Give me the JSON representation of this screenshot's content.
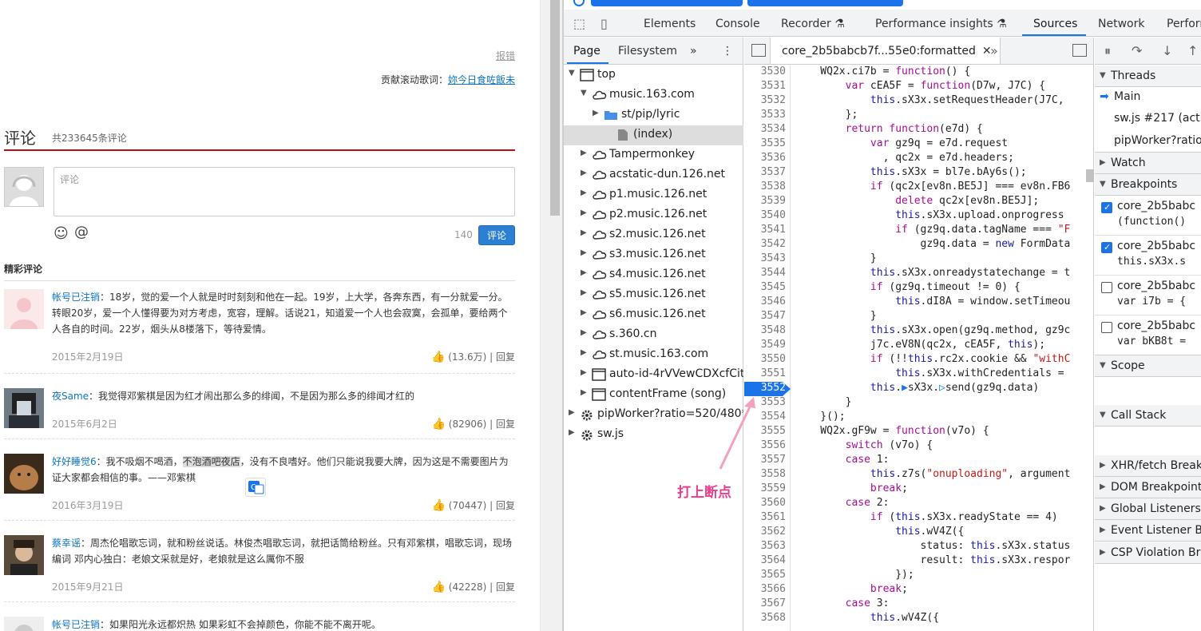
{
  "page": {
    "report_link": "报错",
    "contrib_label": "贡献滚动歌词：",
    "contrib_user": "妳今日食咗飯未",
    "comments_title": "评论",
    "comments_count": "共233645条评论",
    "input_placeholder": "评论",
    "char_count": "140",
    "submit_label": "评论",
    "section_title": "精彩评论",
    "comments": [
      {
        "user": "帐号已注销",
        "text": "：18岁，觉的爱一个人就是时时刻刻和他在一起。19岁，上大学，各奔东西，有一分就爱一分。转眼20岁，爱一个人懂得要为对方考虑，宽容，理解。话说21，知道爱一个人也会寂寞，会孤单，要给两个人各自的时间。22岁，烟头从8楼落下，等待爱情。",
        "date": "2015年2月19日",
        "likes": "(13.6万)",
        "reply": "回复"
      },
      {
        "user": "夜Same",
        "text": "：我觉得邓紫棋是因为红才闹出那么多的绯闻，不是因为那么多的绯闻才红的",
        "date": "2015年6月2日",
        "likes": "(82906)",
        "reply": "回复"
      },
      {
        "user": "好好睡觉6",
        "text_a": "：我不吸烟不喝酒，",
        "text_hl": "不泡酒吧夜店",
        "text_b": "，没有不良嗜好。他们只能说我要大牌，因为这是不需要图片为证大家都会相信的事。——邓紫棋",
        "date": "2016年3月19日",
        "likes": "(70447)",
        "reply": "回复"
      },
      {
        "user": "蔡幸谣",
        "text": "：周杰伦唱歌忘词，就和粉丝说话。林俊杰唱歌忘词，就把话筒给粉丝。只有邓紫棋，唱歌忘词，现场编词 邓内心独白：老娘文采就是好，老娘就是这么厲你不服",
        "date": "2015年9月21日",
        "likes": "(42228)",
        "reply": "回复"
      },
      {
        "user": "帐号已注销",
        "text": "：如果阳光永远都炽热 如果彩虹不会掉颜色，你能不能不离开呢。"
      }
    ]
  },
  "devtools": {
    "tabs": [
      "Elements",
      "Console",
      "Recorder",
      "Performance insights",
      "Sources",
      "Network",
      "Perform"
    ],
    "active_tab": "Sources",
    "nav_tabs": [
      "Page",
      "Filesystem"
    ],
    "tree": [
      {
        "label": "top",
        "indent": 0,
        "arrow": "▼",
        "icon": "frame"
      },
      {
        "label": "music.163.com",
        "indent": 1,
        "arrow": "▼",
        "icon": "cloud"
      },
      {
        "label": "st/pip/lyric",
        "indent": 2,
        "arrow": "▶",
        "icon": "folder"
      },
      {
        "label": "(index)",
        "indent": 3,
        "arrow": "",
        "icon": "file",
        "selected": true
      },
      {
        "label": "Tampermonkey",
        "indent": 1,
        "arrow": "▶",
        "icon": "cloud"
      },
      {
        "label": "acstatic-dun.126.net",
        "indent": 1,
        "arrow": "▶",
        "icon": "cloud"
      },
      {
        "label": "p1.music.126.net",
        "indent": 1,
        "arrow": "▶",
        "icon": "cloud"
      },
      {
        "label": "p2.music.126.net",
        "indent": 1,
        "arrow": "▶",
        "icon": "cloud"
      },
      {
        "label": "s2.music.126.net",
        "indent": 1,
        "arrow": "▶",
        "icon": "cloud"
      },
      {
        "label": "s3.music.126.net",
        "indent": 1,
        "arrow": "▶",
        "icon": "cloud"
      },
      {
        "label": "s4.music.126.net",
        "indent": 1,
        "arrow": "▶",
        "icon": "cloud"
      },
      {
        "label": "s5.music.126.net",
        "indent": 1,
        "arrow": "▶",
        "icon": "cloud"
      },
      {
        "label": "s6.music.126.net",
        "indent": 1,
        "arrow": "▶",
        "icon": "cloud"
      },
      {
        "label": "s.360.cn",
        "indent": 1,
        "arrow": "▶",
        "icon": "cloud"
      },
      {
        "label": "st.music.163.com",
        "indent": 1,
        "arrow": "▶",
        "icon": "cloud"
      },
      {
        "label": "auto-id-4rVVewCDXcfCit",
        "indent": 1,
        "arrow": "▶",
        "icon": "frame"
      },
      {
        "label": "contentFrame (song)",
        "indent": 1,
        "arrow": "▶",
        "icon": "frame"
      },
      {
        "label": "pipWorker?ratio=520/480*",
        "indent": 0,
        "arrow": "▶",
        "icon": "gear"
      },
      {
        "label": "sw.js",
        "indent": 0,
        "arrow": "▶",
        "icon": "gear"
      }
    ],
    "file_tab": "core_2b5babcb7f...55e0:formatted",
    "breakpoint_line": "3552",
    "code_lines": [
      [
        "3530",
        "    WQ2x.ci7b = function() {"
      ],
      [
        "3531",
        "        var cEA5F = function(D7w, J7C) {"
      ],
      [
        "3532",
        "            this.sX3x.setRequestHeader(J7C,"
      ],
      [
        "3533",
        "        };"
      ],
      [
        "3534",
        "        return function(e7d) {"
      ],
      [
        "3535",
        "            var gz9q = e7d.request"
      ],
      [
        "3536",
        "              , qc2x = e7d.headers;"
      ],
      [
        "3537",
        "            this.sX3x = bl7e.bAy6s();"
      ],
      [
        "3538",
        "            if (qc2x[ev8n.BE5J] === ev8n.FB6"
      ],
      [
        "3539",
        "                delete qc2x[ev8n.BE5J];"
      ],
      [
        "3540",
        "                this.sX3x.upload.onprogress"
      ],
      [
        "3541",
        "                if (gz9q.data.tagName === \"F"
      ],
      [
        "3542",
        "                    gz9q.data = new FormData"
      ],
      [
        "3543",
        "            }"
      ],
      [
        "3544",
        "            this.sX3x.onreadystatechange = t"
      ],
      [
        "3545",
        "            if (gz9q.timeout != 0) {"
      ],
      [
        "3546",
        "                this.dI8A = window.setTimeou"
      ],
      [
        "3547",
        "            }"
      ],
      [
        "3548",
        "            this.sX3x.open(gz9q.method, gz9c"
      ],
      [
        "3549",
        "            j7c.eV8N(qc2x, cEA5F, this);"
      ],
      [
        "3550",
        "            if (!!this.rc2x.cookie && \"withC"
      ],
      [
        "3551",
        "                this.sX3x.withCredentials ="
      ],
      [
        "3552",
        "            this.▶sX3x.▷send(gz9q.data)"
      ],
      [
        "3553",
        "        }"
      ],
      [
        "3554",
        "    }();"
      ],
      [
        "3555",
        "    WQ2x.gF9w = function(v7o) {"
      ],
      [
        "3556",
        "        switch (v7o) {"
      ],
      [
        "3557",
        "        case 1:"
      ],
      [
        "3558",
        "            this.z7s(\"onuploading\", argument"
      ],
      [
        "3559",
        "            break;"
      ],
      [
        "3560",
        "        case 2:"
      ],
      [
        "3561",
        "            if (this.sX3x.readyState == 4)"
      ],
      [
        "3562",
        "                this.wV4Z({"
      ],
      [
        "3563",
        "                    status: this.sX3x.status"
      ],
      [
        "3564",
        "                    result: this.sX3x.respor"
      ],
      [
        "3565",
        "                });"
      ],
      [
        "3566",
        "            break;"
      ],
      [
        "3567",
        "        case 3:"
      ],
      [
        "3568",
        "            this.wV4Z({"
      ]
    ],
    "annotation": "打上断点",
    "sidebar": {
      "threads_title": "Threads",
      "threads": [
        "Main",
        "sw.js #217 (activa",
        "pipWorker?ratio="
      ],
      "watch_title": "Watch",
      "breakpoints_title": "Breakpoints",
      "breakpoints": [
        {
          "file": "core_2b5babc",
          "code": "(function()",
          "checked": true
        },
        {
          "file": "core_2b5babc",
          "code": "this.sX3x.s",
          "checked": true
        },
        {
          "file": "core_2b5babc",
          "code": "var i7b = {",
          "checked": false
        },
        {
          "file": "core_2b5babc",
          "code": "var bKB8t =",
          "checked": false
        }
      ],
      "scope_title": "Scope",
      "callstack_title": "Call Stack",
      "more_sections": [
        "XHR/fetch Breakp",
        "DOM Breakpoints",
        "Global Listeners",
        "Event Listener Bre",
        "CSP Violation Bre"
      ]
    }
  }
}
